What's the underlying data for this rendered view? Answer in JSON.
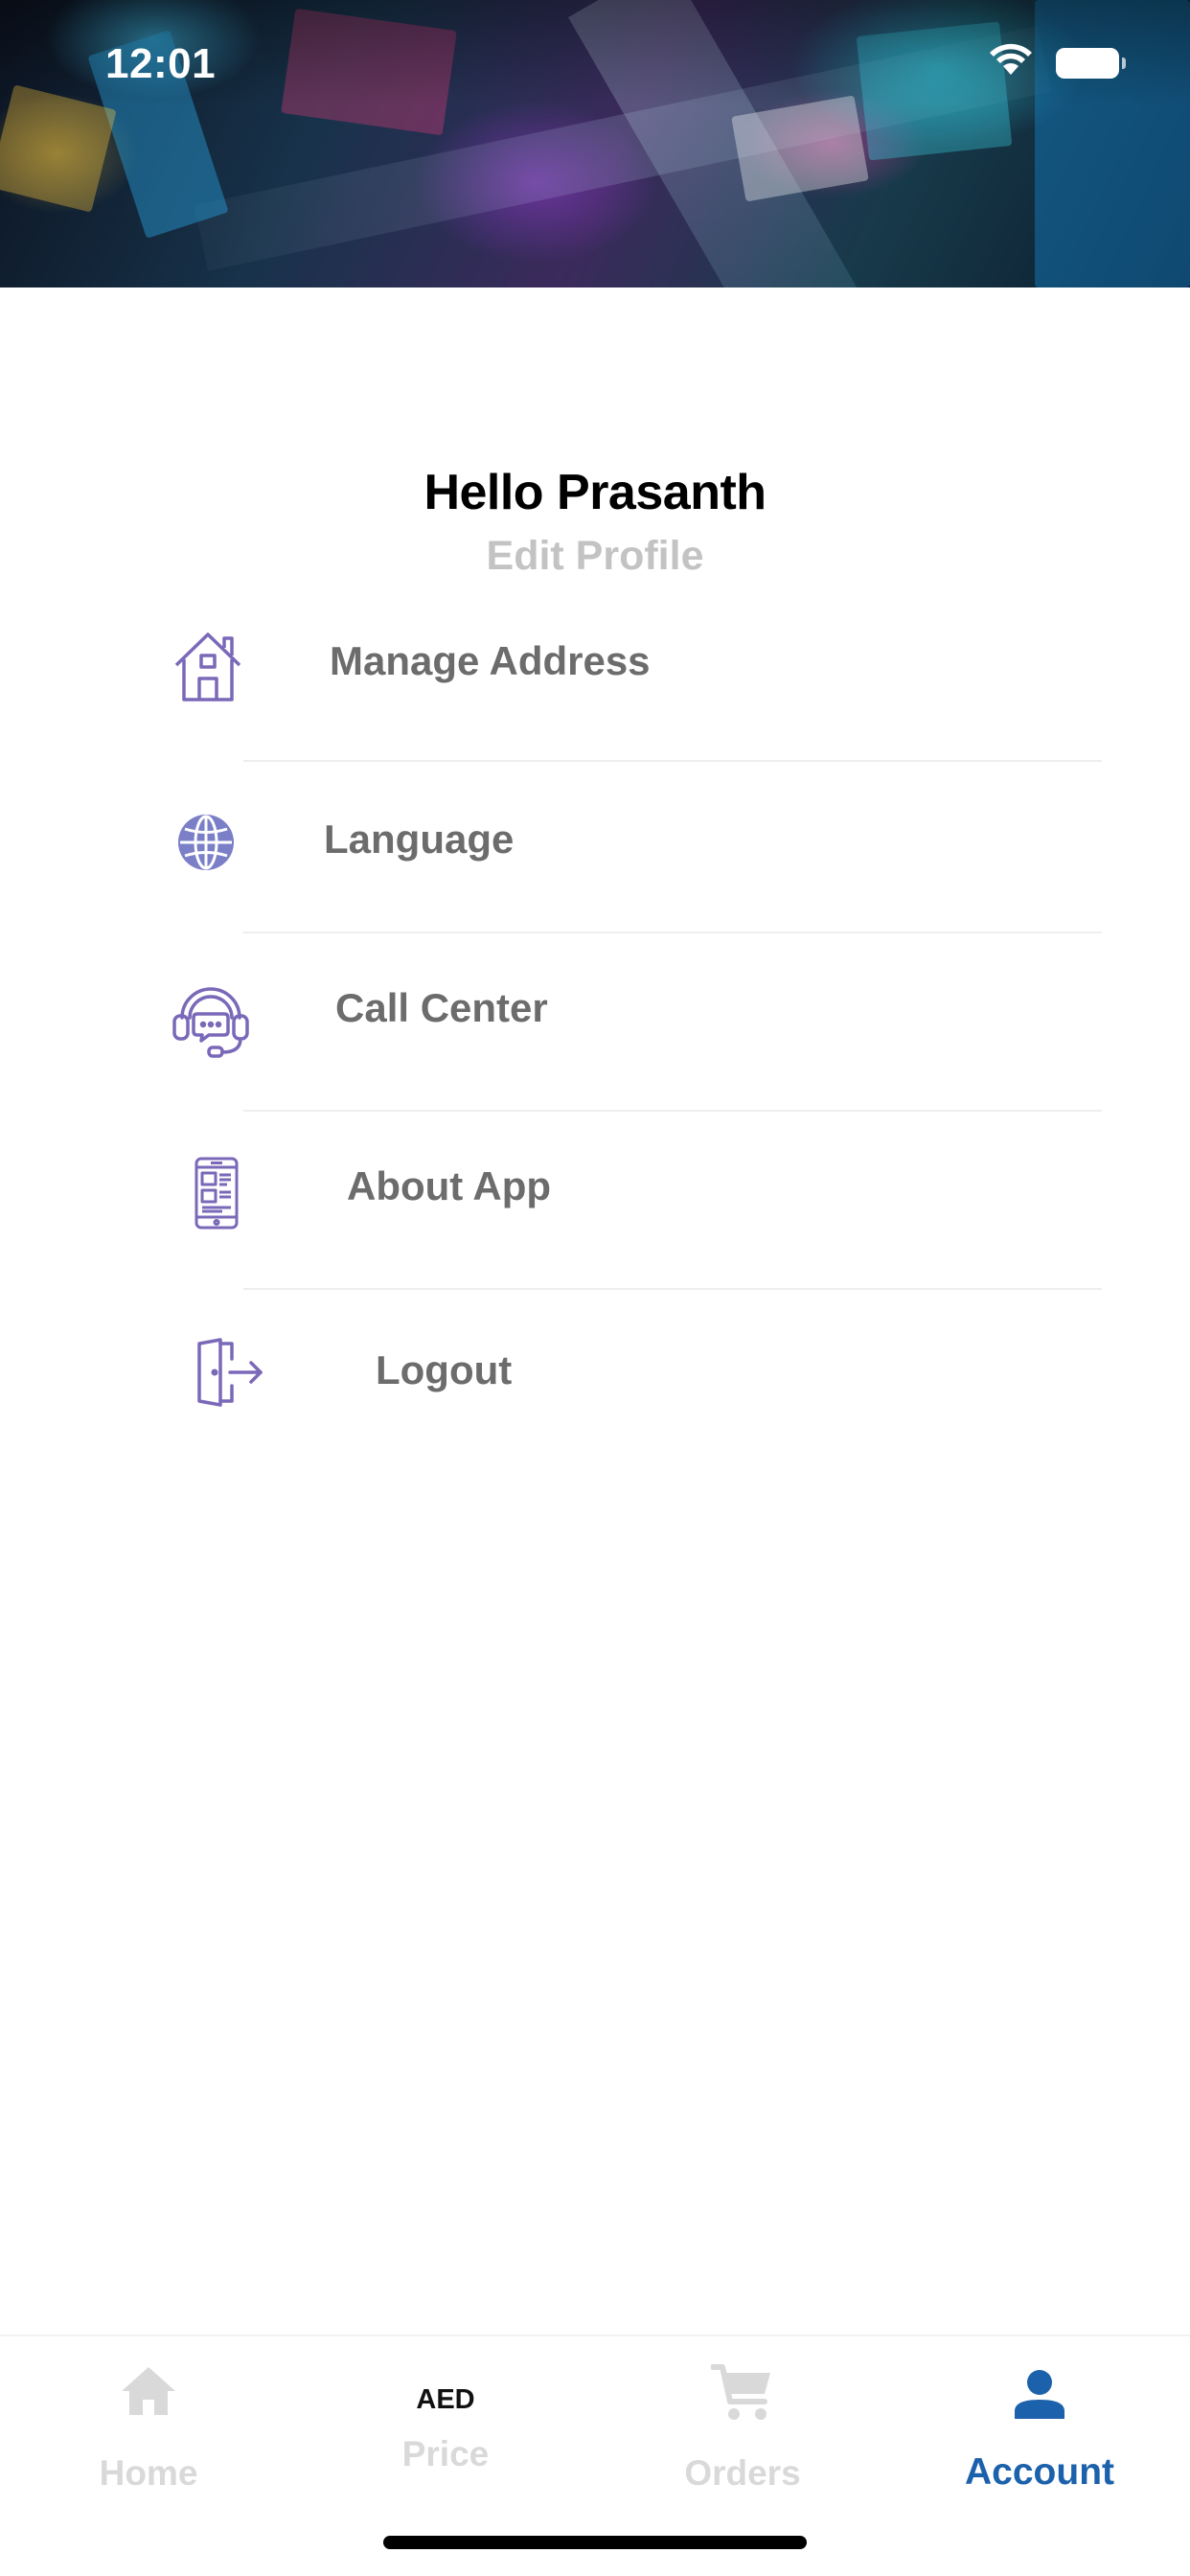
{
  "status_bar": {
    "time": "12:01"
  },
  "profile": {
    "greeting": "Hello Prasanth",
    "edit_profile_label": "Edit Profile"
  },
  "menu": {
    "items": [
      {
        "label": "Manage Address",
        "icon": "house-icon"
      },
      {
        "label": "Language",
        "icon": "globe-icon"
      },
      {
        "label": "Call Center",
        "icon": "headset-support-icon"
      },
      {
        "label": "About App",
        "icon": "mobile-app-icon"
      },
      {
        "label": "Logout",
        "icon": "logout-door-icon"
      }
    ]
  },
  "bottom_nav": {
    "tabs": [
      {
        "label": "Home",
        "icon": "home-icon",
        "active": false
      },
      {
        "label": "Price",
        "icon_text": "AED",
        "active": false
      },
      {
        "label": "Orders",
        "icon": "cart-icon",
        "active": false
      },
      {
        "label": "Account",
        "icon": "person-icon",
        "active": true
      }
    ]
  },
  "colors": {
    "icon_accent": "#7a68b8",
    "active_tab": "#1c61ab",
    "inactive_tab": "#d9d9d9",
    "menu_text": "#6c6c6c"
  }
}
